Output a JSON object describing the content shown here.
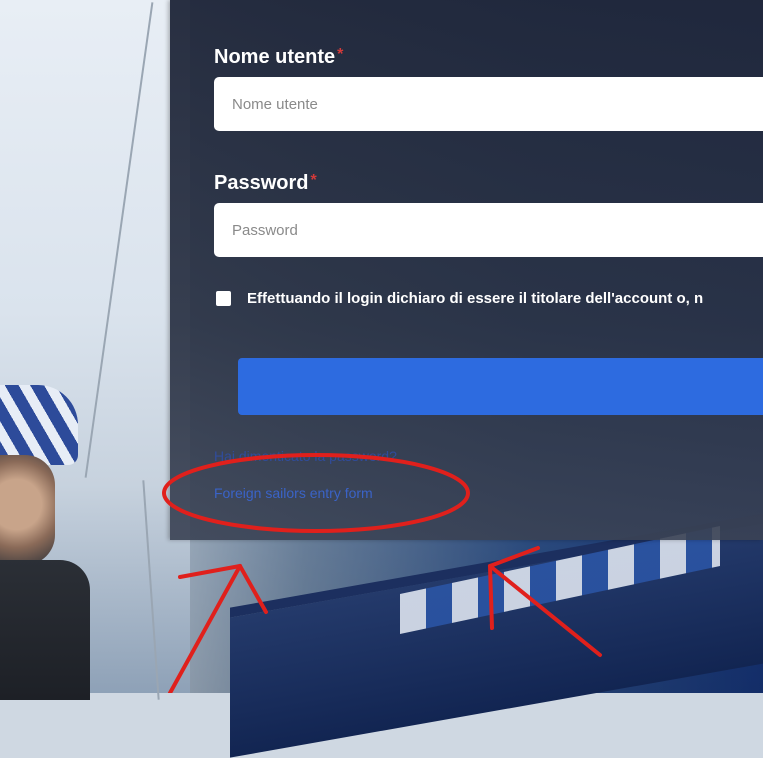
{
  "login": {
    "username_label": "Nome utente",
    "username_required": "*",
    "username_placeholder": "Nome utente",
    "password_label": "Password",
    "password_required": "*",
    "password_placeholder": "Password",
    "consent_text": "Effettuando il login dichiaro di essere il titolare dell'account o, n",
    "submit_label": "",
    "forgot_password_link": "Hai dimenticato la password?",
    "foreign_sailors_link": "Foreign sailors entry form"
  },
  "colors": {
    "panel_bg": "#262d40",
    "submit_button": "#2d6be0",
    "link": "#3a63c7",
    "required_marker": "#d23a3a",
    "annotation": "#e0201c"
  }
}
